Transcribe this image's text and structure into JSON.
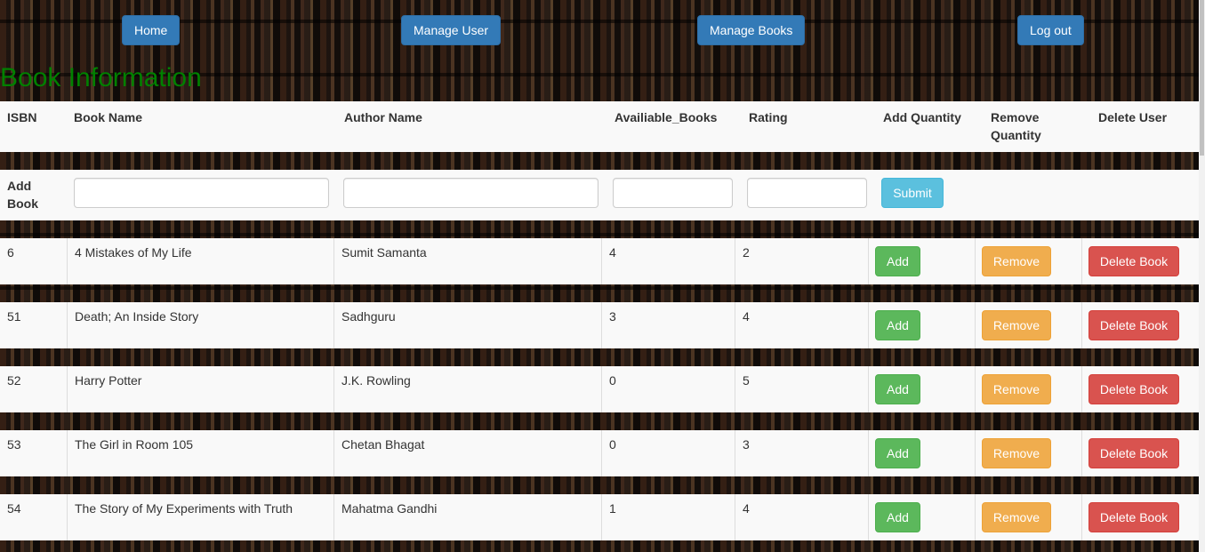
{
  "nav": {
    "home": "Home",
    "manage_user": "Manage User",
    "manage_books": "Manage Books",
    "logout": "Log out"
  },
  "page_title": "Book Information",
  "table": {
    "headers": [
      "ISBN",
      "Book Name",
      "Author Name",
      "Availiable_Books",
      "Rating",
      "Add Quantity",
      "Remove Quantity",
      "Delete User"
    ],
    "add_row_label": "Add Book",
    "submit_label": "Submit",
    "add_label": "Add",
    "remove_label": "Remove",
    "delete_label": "Delete Book",
    "rows": [
      {
        "isbn": "6",
        "name": "4 Mistakes of My Life",
        "author": "Sumit Samanta",
        "available": "4",
        "rating": "2"
      },
      {
        "isbn": "51",
        "name": "Death; An Inside Story",
        "author": "Sadhguru",
        "available": "3",
        "rating": "4"
      },
      {
        "isbn": "52",
        "name": "Harry Potter",
        "author": "J.K. Rowling",
        "available": "0",
        "rating": "5"
      },
      {
        "isbn": "53",
        "name": "The Girl in Room 105",
        "author": "Chetan Bhagat",
        "available": "0",
        "rating": "3"
      },
      {
        "isbn": "54",
        "name": "The Story of My Experiments with Truth",
        "author": "Mahatma Gandhi",
        "available": "1",
        "rating": "4"
      }
    ]
  },
  "colors": {
    "primary": "#337ab7",
    "title": "#008000",
    "submit": "#5bc0de",
    "add": "#5cb85c",
    "remove": "#f0ad4e",
    "delete": "#d9534f"
  }
}
